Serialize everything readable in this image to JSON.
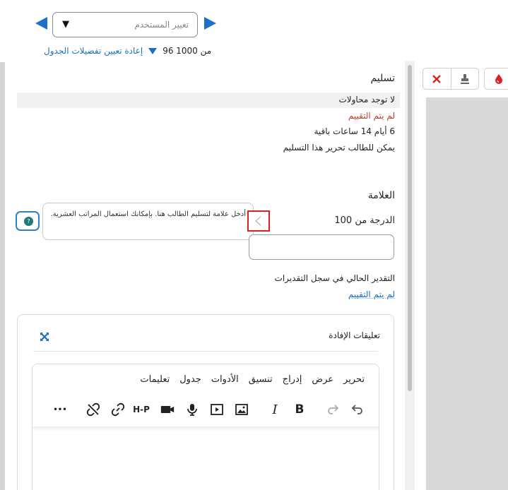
{
  "header": {
    "user_select_placeholder": "تغيير المستخدم",
    "user_select_caret": "▼",
    "reset_link": "إعادة تعيين تفضيلات الجدول",
    "count_text": "96 من 1000"
  },
  "submission": {
    "title": "تسليم",
    "attempts": "لا توجد محاولات",
    "status": "لم يتم التقييم",
    "time_remaining": "6 أيام 14 ساعات باقية",
    "edit_note": "يمكن للطالب تحرير هذا التسليم"
  },
  "grade": {
    "title": "العلامة",
    "label": "الدرجة من 100",
    "tooltip": "أدخل علامة لتسليم الطالب هنا. بإمكانك استعمال المراتب العشرية.",
    "help_glyph": "?",
    "gradebook_label": "التقدير الحالي في سجل التقديرات",
    "gradebook_value": "لم يتم التقييم"
  },
  "feedback": {
    "title": "تعليقات الإفادة",
    "menu": [
      "تحرير",
      "عرض",
      "إدراج",
      "تنسيق",
      "الأدوات",
      "جدول",
      "تعليمات"
    ],
    "more": "•••",
    "h5p": "H-P"
  },
  "colors": {
    "accent": "#1a73c8",
    "link": "#1a6fc0",
    "danger": "#c0392b",
    "highlight": "#e02020",
    "help_dot": "#1d7a78"
  }
}
